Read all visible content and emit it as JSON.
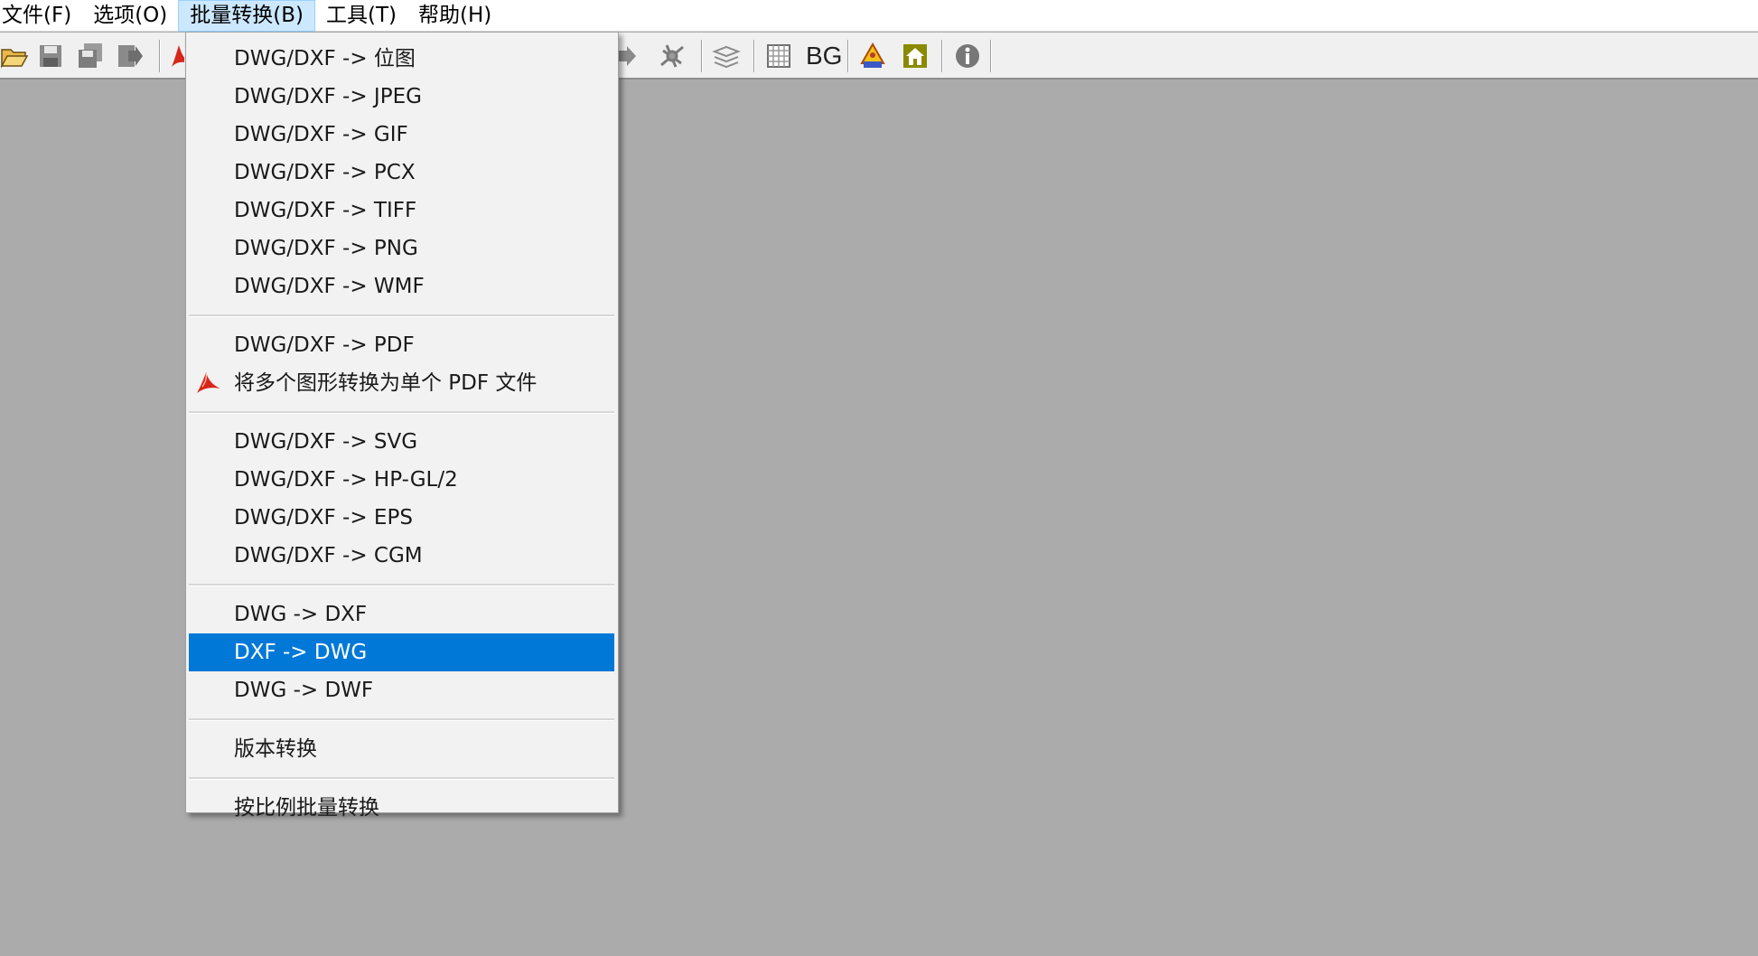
{
  "menubar": {
    "items": [
      {
        "label": "文件(F)"
      },
      {
        "label": "选项(O)"
      },
      {
        "label": "批量转换(B)"
      },
      {
        "label": "工具(T)"
      },
      {
        "label": "帮助(H)"
      }
    ]
  },
  "toolbar": {
    "bg_label": "BG"
  },
  "dropdown": {
    "items": [
      {
        "label": "DWG/DXF -> 位图"
      },
      {
        "label": "DWG/DXF -> JPEG"
      },
      {
        "label": "DWG/DXF -> GIF"
      },
      {
        "label": "DWG/DXF -> PCX"
      },
      {
        "label": "DWG/DXF -> TIFF"
      },
      {
        "label": "DWG/DXF -> PNG"
      },
      {
        "label": "DWG/DXF -> WMF"
      },
      {
        "label": "DWG/DXF -> PDF"
      },
      {
        "label": "将多个图形转换为单个 PDF 文件"
      },
      {
        "label": "DWG/DXF -> SVG"
      },
      {
        "label": "DWG/DXF -> HP-GL/2"
      },
      {
        "label": "DWG/DXF -> EPS"
      },
      {
        "label": "DWG/DXF -> CGM"
      },
      {
        "label": "DWG -> DXF"
      },
      {
        "label": "DXF -> DWG"
      },
      {
        "label": "DWG -> DWF"
      },
      {
        "label": "版本转换"
      },
      {
        "label": "按比例批量转换"
      }
    ]
  },
  "colors": {
    "highlight": "#0078d7",
    "workspace": "#ababab",
    "menubar_active": "#cce8ff"
  }
}
